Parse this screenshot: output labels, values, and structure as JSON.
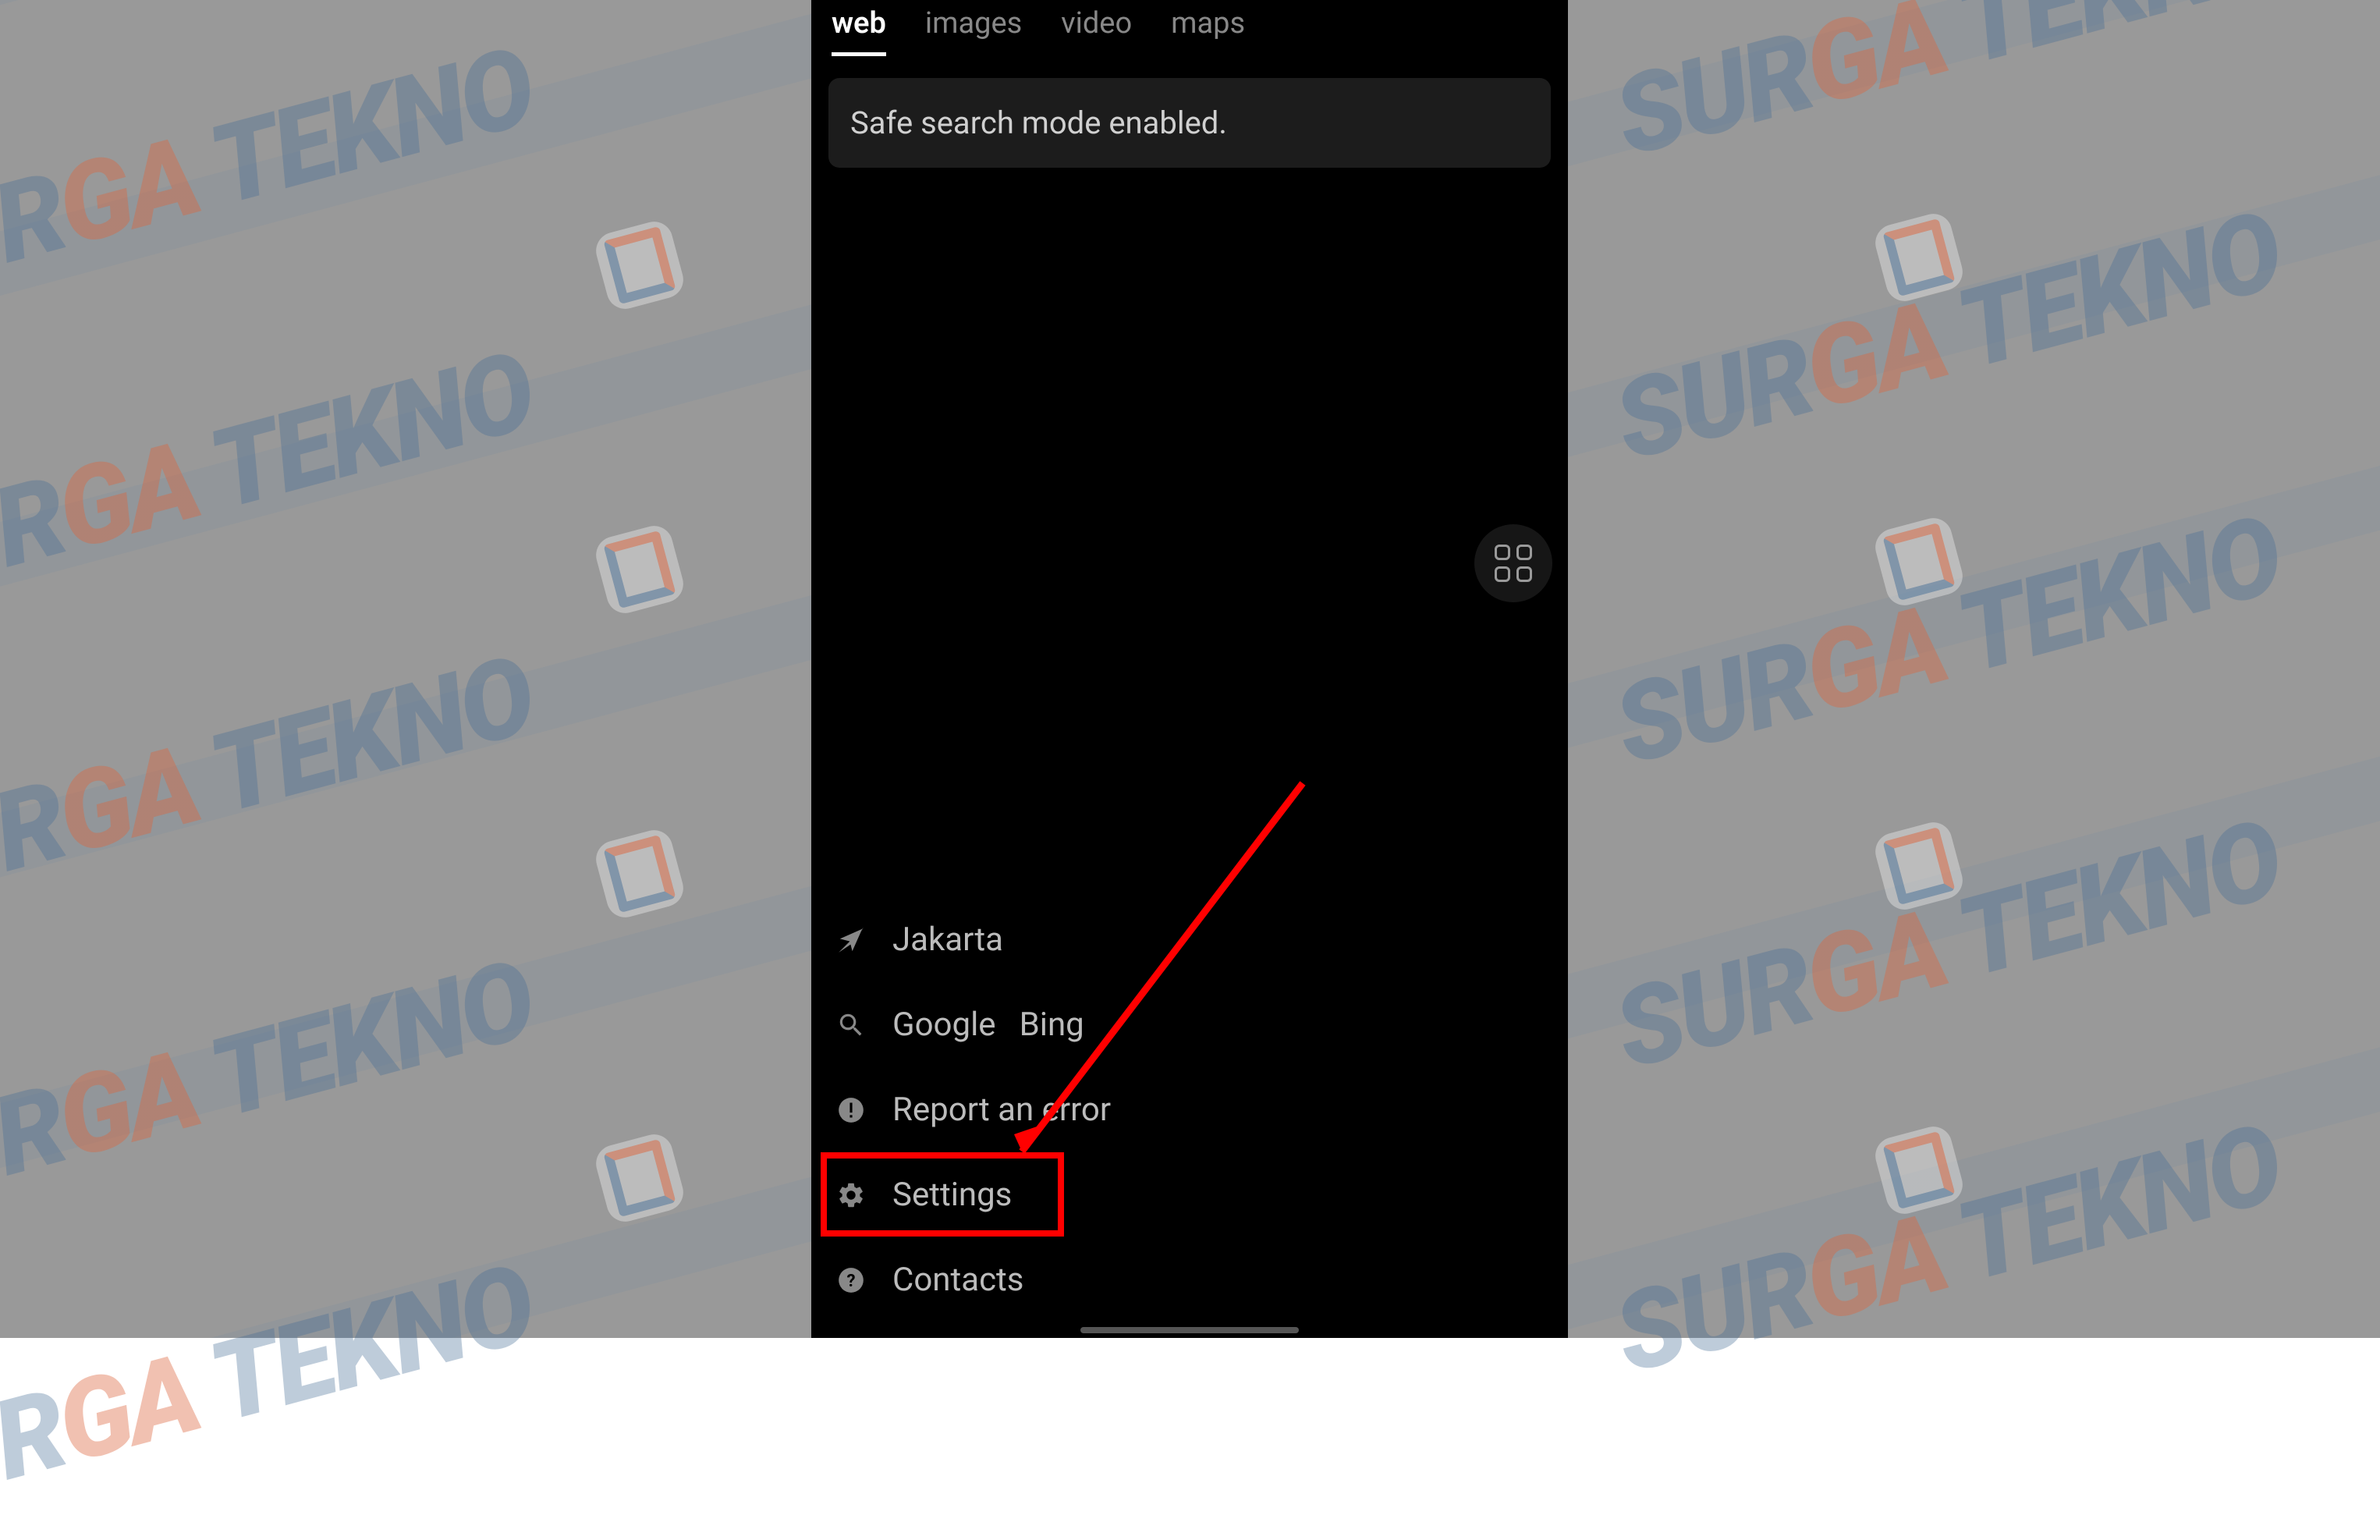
{
  "tabs": {
    "web": "web",
    "images": "images",
    "video": "video",
    "maps": "maps",
    "active": "web"
  },
  "notice": {
    "text": "Safe search mode enabled."
  },
  "footer": {
    "location": {
      "label": "Jakarta"
    },
    "search_engines": {
      "google": "Google",
      "bing": "Bing"
    },
    "report": {
      "label": "Report an error"
    },
    "settings": {
      "label": "Settings"
    },
    "contacts": {
      "label": "Contacts"
    }
  },
  "watermark": {
    "brand_part1": "SUR",
    "brand_part2": "GA",
    "brand_part3": " TEKNO"
  },
  "annotation": {
    "highlight_color": "#ff0000"
  }
}
